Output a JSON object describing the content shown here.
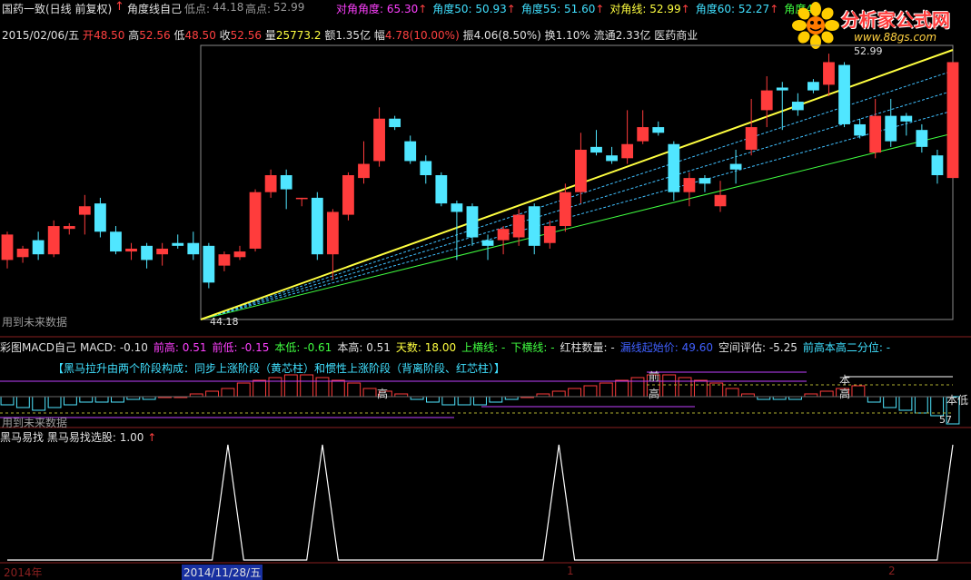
{
  "header": {
    "title": "国药一致(日线 前复权)",
    "indicator": "角度线自己",
    "low_label": "低点:",
    "low_value": "44.18",
    "high_label": "高点:",
    "high_value": "52.99",
    "angle_items": [
      {
        "label": "对角角度:",
        "value": "65.30",
        "color": "#ff40ff"
      },
      {
        "label": "角度50:",
        "value": "50.93",
        "color": "#40e0ff"
      },
      {
        "label": "角度55:",
        "value": "51.60",
        "color": "#40e0ff"
      },
      {
        "label": "对角线:",
        "value": "52.99",
        "color": "#ffff40"
      },
      {
        "label": "角度60:",
        "value": "52.27",
        "color": "#40e0ff"
      },
      {
        "label": "角度45",
        "value": "",
        "color": "#40ff40"
      }
    ]
  },
  "quote": {
    "date": "2015/02/06/五",
    "open_label": "开",
    "open": "48.50",
    "high_label": "高",
    "high": "52.56",
    "low_label": "低",
    "low": "48.50",
    "close_label": "收",
    "close": "52.56",
    "volume_label": "量",
    "volume": "25773.2",
    "amount_label": "额",
    "amount": "1.35亿",
    "change_label": "幅",
    "change": "4.78(10.00%)",
    "amplitude_label": "振",
    "amplitude": "4.06(8.50%)",
    "turnover_label": "换",
    "turnover": "1.10%",
    "float_label": "流通",
    "float": "2.33亿",
    "sector": "医药商业"
  },
  "logo": {
    "title": "分析家公式网",
    "url": "www.88gs.com"
  },
  "main_chart": {
    "top_value_label": "52.99",
    "bottom_value_label": "44.18",
    "future_data_label": "用到未来数据",
    "candles": [
      {
        "o": 45.6,
        "c": 46.5,
        "h": 46.6,
        "l": 45.3
      },
      {
        "o": 45.7,
        "c": 46.0,
        "h": 46.1,
        "l": 45.5
      },
      {
        "o": 46.3,
        "c": 45.8,
        "h": 46.6,
        "l": 45.6
      },
      {
        "o": 45.8,
        "c": 46.8,
        "h": 47.0,
        "l": 45.7
      },
      {
        "o": 46.7,
        "c": 46.8,
        "h": 46.9,
        "l": 46.5
      },
      {
        "o": 47.2,
        "c": 47.5,
        "h": 47.9,
        "l": 46.5
      },
      {
        "o": 47.6,
        "c": 46.6,
        "h": 47.8,
        "l": 46.4
      },
      {
        "o": 46.6,
        "c": 45.9,
        "h": 46.8,
        "l": 45.8
      },
      {
        "o": 45.9,
        "c": 46.0,
        "h": 46.2,
        "l": 45.6
      },
      {
        "o": 46.1,
        "c": 45.6,
        "h": 46.2,
        "l": 45.3
      },
      {
        "o": 45.8,
        "c": 46.0,
        "h": 46.2,
        "l": 45.4
      },
      {
        "o": 46.2,
        "c": 46.1,
        "h": 46.5,
        "l": 46.0
      },
      {
        "o": 46.2,
        "c": 45.8,
        "h": 46.6,
        "l": 45.6
      },
      {
        "o": 46.1,
        "c": 44.8,
        "h": 46.2,
        "l": 44.6
      },
      {
        "o": 45.4,
        "c": 45.8,
        "h": 45.9,
        "l": 45.2
      },
      {
        "o": 45.7,
        "c": 45.9,
        "h": 46.1,
        "l": 45.6
      },
      {
        "o": 46.0,
        "c": 48.0,
        "h": 48.1,
        "l": 45.9
      },
      {
        "o": 48.0,
        "c": 48.6,
        "h": 48.8,
        "l": 47.8
      },
      {
        "o": 48.6,
        "c": 48.1,
        "h": 48.8,
        "l": 47.4
      },
      {
        "o": 47.8,
        "c": 47.8,
        "h": 47.8,
        "l": 47.5
      },
      {
        "o": 47.8,
        "c": 45.8,
        "h": 48.0,
        "l": 45.6
      },
      {
        "o": 45.8,
        "c": 47.3,
        "h": 47.4,
        "l": 44.9
      },
      {
        "o": 47.2,
        "c": 48.6,
        "h": 48.7,
        "l": 47.0
      },
      {
        "o": 48.5,
        "c": 49.0,
        "h": 49.8,
        "l": 48.3
      },
      {
        "o": 49.1,
        "c": 50.6,
        "h": 51.0,
        "l": 48.9
      },
      {
        "o": 50.6,
        "c": 50.3,
        "h": 50.7,
        "l": 50.2
      },
      {
        "o": 49.8,
        "c": 49.1,
        "h": 50.0,
        "l": 49.0
      },
      {
        "o": 49.1,
        "c": 48.6,
        "h": 49.3,
        "l": 48.3
      },
      {
        "o": 48.6,
        "c": 47.6,
        "h": 48.7,
        "l": 47.5
      },
      {
        "o": 47.6,
        "c": 47.3,
        "h": 47.7,
        "l": 45.6
      },
      {
        "o": 47.5,
        "c": 46.4,
        "h": 47.6,
        "l": 46.1
      },
      {
        "o": 46.3,
        "c": 46.1,
        "h": 46.5,
        "l": 45.6
      },
      {
        "o": 46.3,
        "c": 46.7,
        "h": 46.8,
        "l": 45.8
      },
      {
        "o": 46.4,
        "c": 47.2,
        "h": 47.4,
        "l": 46.1
      },
      {
        "o": 47.5,
        "c": 46.1,
        "h": 47.6,
        "l": 45.8
      },
      {
        "o": 46.2,
        "c": 46.8,
        "h": 47.0,
        "l": 46.0
      },
      {
        "o": 46.8,
        "c": 48.0,
        "h": 48.3,
        "l": 46.6
      },
      {
        "o": 48.0,
        "c": 49.5,
        "h": 50.1,
        "l": 47.6
      },
      {
        "o": 49.6,
        "c": 49.4,
        "h": 50.2,
        "l": 49.3
      },
      {
        "o": 49.3,
        "c": 49.1,
        "h": 49.6,
        "l": 49.0
      },
      {
        "o": 49.2,
        "c": 49.7,
        "h": 50.9,
        "l": 49.0
      },
      {
        "o": 49.8,
        "c": 50.3,
        "h": 50.9,
        "l": 49.7
      },
      {
        "o": 50.3,
        "c": 50.1,
        "h": 50.5,
        "l": 50.0
      },
      {
        "o": 49.7,
        "c": 48.0,
        "h": 49.8,
        "l": 47.7
      },
      {
        "o": 48.0,
        "c": 48.5,
        "h": 48.7,
        "l": 47.5
      },
      {
        "o": 48.5,
        "c": 48.3,
        "h": 48.6,
        "l": 48.0
      },
      {
        "o": 47.5,
        "c": 47.9,
        "h": 48.4,
        "l": 47.3
      },
      {
        "o": 49.0,
        "c": 48.8,
        "h": 49.5,
        "l": 48.3
      },
      {
        "o": 49.5,
        "c": 50.3,
        "h": 51.3,
        "l": 49.3
      },
      {
        "o": 50.9,
        "c": 51.6,
        "h": 52.1,
        "l": 50.3
      },
      {
        "o": 51.7,
        "c": 51.6,
        "h": 51.9,
        "l": 50.2
      },
      {
        "o": 51.2,
        "c": 50.9,
        "h": 51.5,
        "l": 50.7
      },
      {
        "o": 51.9,
        "c": 51.6,
        "h": 52.0,
        "l": 51.5
      },
      {
        "o": 51.8,
        "c": 52.6,
        "h": 52.9,
        "l": 51.4
      },
      {
        "o": 52.5,
        "c": 50.4,
        "h": 52.6,
        "l": 50.3
      },
      {
        "o": 50.4,
        "c": 50.0,
        "h": 50.6,
        "l": 49.9
      },
      {
        "o": 49.4,
        "c": 50.7,
        "h": 51.3,
        "l": 49.2
      },
      {
        "o": 50.7,
        "c": 49.8,
        "h": 51.3,
        "l": 49.6
      },
      {
        "o": 50.7,
        "c": 50.5,
        "h": 50.8,
        "l": 50.0
      },
      {
        "o": 50.2,
        "c": 49.6,
        "h": 50.4,
        "l": 49.4
      },
      {
        "o": 49.3,
        "c": 48.6,
        "h": 49.5,
        "l": 48.3
      },
      {
        "o": 48.5,
        "c": 52.6,
        "h": 52.6,
        "l": 48.5
      }
    ]
  },
  "macd_panel": {
    "title": "彩图MACD自己",
    "items": [
      {
        "label": "MACD:",
        "value": "-0.10",
        "color": "#e0e0e0"
      },
      {
        "label": "前高:",
        "value": "0.51",
        "color": "#ff40ff"
      },
      {
        "label": "前低:",
        "value": "-0.15",
        "color": "#ff40ff"
      },
      {
        "label": "本低:",
        "value": "-0.61",
        "color": "#40ff40"
      },
      {
        "label": "本高:",
        "value": "0.51",
        "color": "#e0e0e0"
      },
      {
        "label": "天数:",
        "value": "18.00",
        "color": "#ffff40"
      },
      {
        "label": "上横线:",
        "value": "-",
        "color": "#40ff40"
      },
      {
        "label": "下横线:",
        "value": "-",
        "color": "#40ff40"
      },
      {
        "label": "红柱数量:",
        "value": "-",
        "color": "#e0e0e0"
      },
      {
        "label": "漏线起始价:",
        "value": "49.60",
        "color": "#4060ff"
      },
      {
        "label": "空间评估:",
        "value": "-5.25",
        "color": "#e0e0e0"
      },
      {
        "label": "前高本高二分位:",
        "value": "-",
        "color": "#40e0ff"
      }
    ],
    "note": "【黑马拉升由两个阶段构成：同步上涨阶段（黄芯柱）和惯性上涨阶段（背离阶段、红芯柱）】",
    "annotations": [
      "高",
      "前",
      "高",
      "本",
      "高",
      "本低",
      "57"
    ],
    "future_data_label": "用到未来数据"
  },
  "bottom_panel": {
    "title": "黑马易找",
    "sub_label": "黑马易找选股:",
    "sub_value": "1.00",
    "signal": [
      0,
      0,
      0,
      0,
      0,
      0,
      0,
      0,
      0,
      0,
      0,
      0,
      0,
      0,
      1,
      0,
      0,
      0,
      0,
      0,
      1,
      0,
      0,
      0,
      0,
      0,
      0,
      0,
      0,
      0,
      0,
      0,
      0,
      0,
      0,
      1,
      0,
      0,
      0,
      0,
      0,
      0,
      0,
      0,
      0,
      0,
      0,
      0,
      0,
      0,
      0,
      0,
      0,
      0,
      0,
      0,
      0,
      0,
      0,
      0,
      1
    ]
  },
  "axis": {
    "labels": [
      "2014年",
      "2014/11/28/五",
      "1",
      "2"
    ]
  },
  "colors": {
    "up": "#ff3c3c",
    "down": "#50e6ff",
    "diag_line": "#ffff40",
    "angle_lines": "#40c0ff",
    "angle45": "#40ff40"
  }
}
